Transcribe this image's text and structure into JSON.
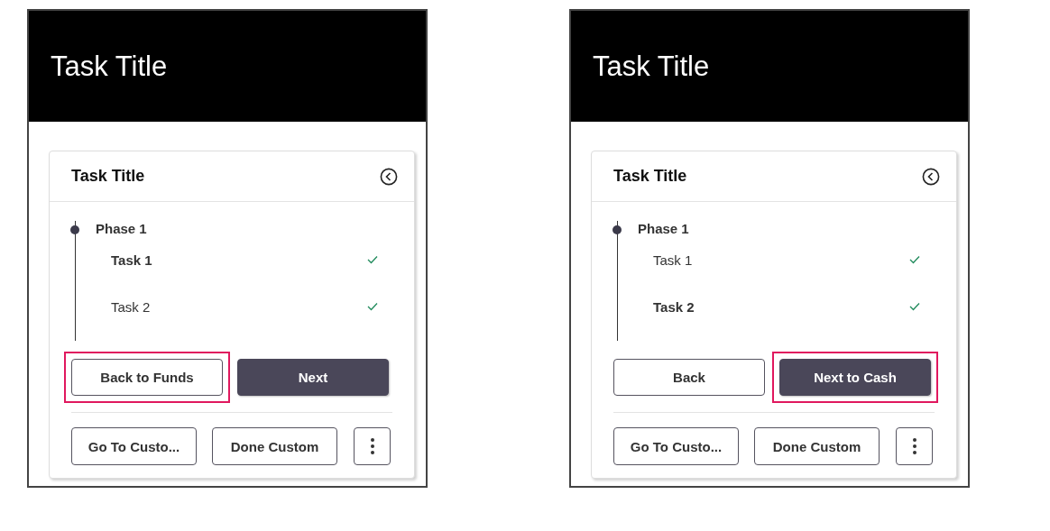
{
  "panels": [
    {
      "header_title": "Task Title",
      "card": {
        "title": "Task Title",
        "phase": "Phase 1",
        "tasks": [
          {
            "label": "Task 1",
            "selected": true,
            "done": true
          },
          {
            "label": "Task 2",
            "selected": false,
            "done": true
          }
        ],
        "nav_buttons": [
          {
            "label": "Back to Funds",
            "kind": "secondary",
            "highlighted": true
          },
          {
            "label": "Next",
            "kind": "primary",
            "highlighted": false
          }
        ],
        "action_buttons": [
          "Go To Custo...",
          "Done Custom"
        ]
      }
    },
    {
      "header_title": "Task Title",
      "card": {
        "title": "Task Title",
        "phase": "Phase 1",
        "tasks": [
          {
            "label": "Task 1",
            "selected": false,
            "done": true
          },
          {
            "label": "Task 2",
            "selected": true,
            "done": true
          }
        ],
        "nav_buttons": [
          {
            "label": "Back",
            "kind": "secondary",
            "highlighted": false
          },
          {
            "label": "Next to Cash",
            "kind": "primary",
            "highlighted": true
          }
        ],
        "action_buttons": [
          "Go To Custo...",
          "Done Custom"
        ]
      }
    }
  ]
}
